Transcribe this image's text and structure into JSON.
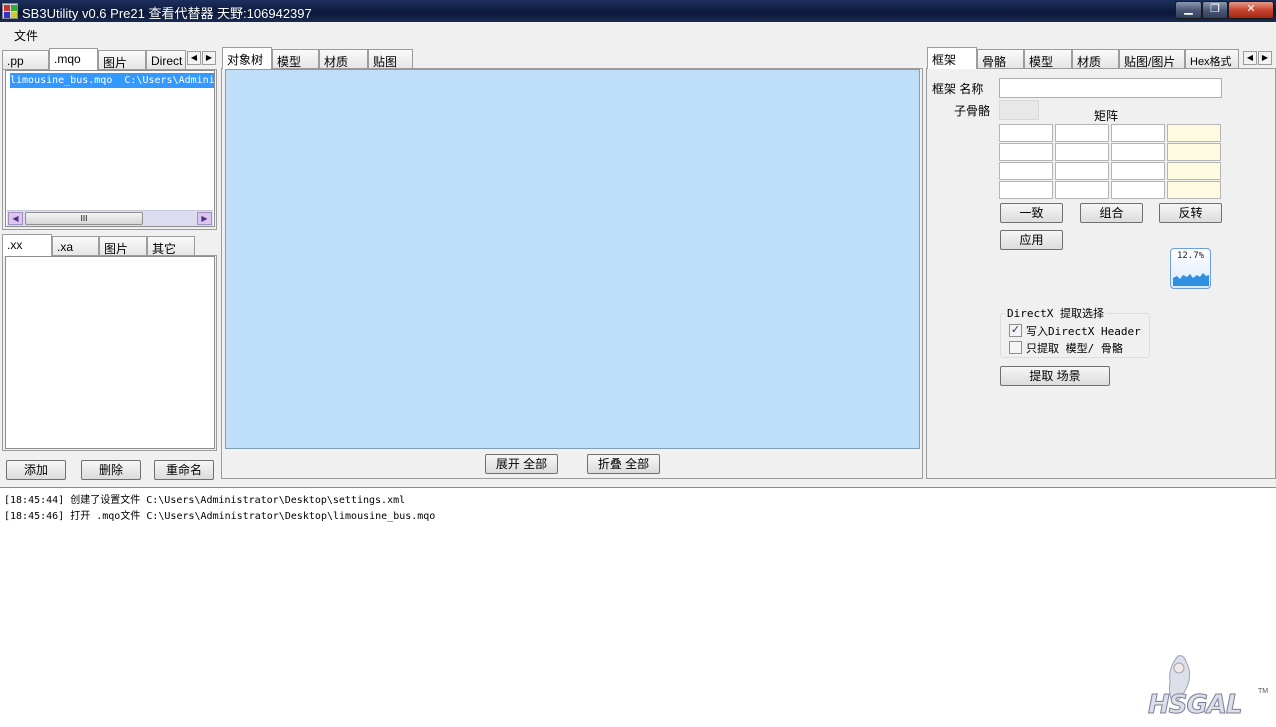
{
  "window": {
    "title": "SB3Utility v0.6 Pre21 查看代替器 天野:106942397",
    "min_icon": "minimize-icon",
    "max_icon": "maximize-icon",
    "close_icon": "close-icon"
  },
  "menu": {
    "file": "文件"
  },
  "left_top_tabs": [
    ".pp",
    ".mqo",
    "图片",
    "Direct"
  ],
  "file_list": {
    "item": "limousine_bus.mqo  C:\\Users\\Admini",
    "scroll_grip": "III"
  },
  "left_bottom_tabs": [
    ".xx",
    ".xa",
    "图片",
    "其它"
  ],
  "left_buttons": {
    "add": "添加",
    "delete": "删除",
    "rename": "重命名"
  },
  "center_tabs": [
    "对象树",
    "模型",
    "材质",
    "贴图"
  ],
  "center_buttons": {
    "expand": "展开 全部",
    "collapse": "折叠 全部"
  },
  "right_tabs": [
    "框架",
    "骨骼",
    "模型",
    "材质",
    "贴图/图片",
    "Hex格式"
  ],
  "frame": {
    "name_label": "框架 名称",
    "child_bone_label": "子骨骼",
    "matrix_label": "矩阵",
    "btn_consistent": "一致",
    "btn_combine": "组合",
    "btn_invert": "反转",
    "btn_apply": "应用",
    "cpu_percent": "12.7%",
    "directx_group": "DirectX 提取选择",
    "chk_header": "写入DirectX Header",
    "chk_header_checked": true,
    "chk_only": "只提取 模型/ 骨骼",
    "chk_only_checked": false,
    "btn_extract": "提取 场景"
  },
  "log": [
    "[18:45:44] 创建了设置文件 C:\\Users\\Administrator\\Desktop\\settings.xml",
    "[18:45:46] 打开 .mqo文件 C:\\Users\\Administrator\\Desktop\\limousine_bus.mqo"
  ],
  "watermark": {
    "logo_text": "HSGAL",
    "tm": "TM"
  },
  "colors": {
    "tree_bg": "#bfdff9",
    "selection": "#3399ff",
    "title_bar": "#0b1838"
  }
}
